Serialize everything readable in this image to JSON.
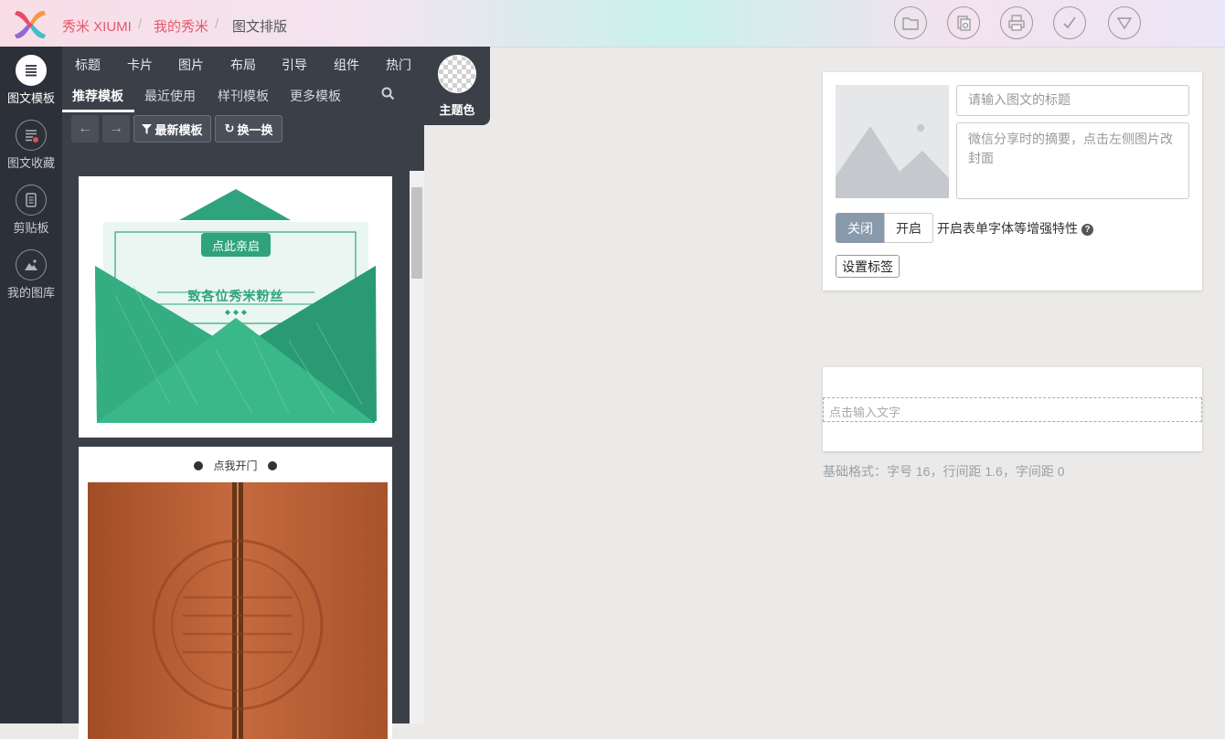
{
  "header": {
    "brand": "秀米 XIUMI",
    "breadcrumbs": [
      "我的秀米",
      "图文排版"
    ],
    "separator": "/",
    "actions": [
      {
        "name": "open-folder",
        "icon": "folder-icon"
      },
      {
        "name": "copy-doc",
        "icon": "copy-doc-icon"
      },
      {
        "name": "print",
        "icon": "printer-icon"
      },
      {
        "name": "save-confirm",
        "icon": "check-icon"
      },
      {
        "name": "more-menu",
        "icon": "triangle-down-icon"
      }
    ]
  },
  "rail": {
    "items": [
      {
        "label": "图文模板",
        "icon": "list-lines-icon",
        "active": true
      },
      {
        "label": "图文收藏",
        "icon": "favorite-list-icon",
        "active": false
      },
      {
        "label": "剪贴板",
        "icon": "clipboard-icon",
        "active": false
      },
      {
        "label": "我的图库",
        "icon": "image-library-icon",
        "active": false
      }
    ]
  },
  "panel": {
    "categories": [
      "标题",
      "卡片",
      "图片",
      "布局",
      "引导",
      "组件",
      "热门"
    ],
    "subtabs": [
      "推荐模板",
      "最近使用",
      "样刊模板",
      "更多模板"
    ],
    "active_subtab": "推荐模板",
    "search_icon": "search-icon",
    "theme_color_label": "主题色",
    "filter_button": "最新模板",
    "shuffle_button": "换一换",
    "templates": [
      {
        "kind": "envelope",
        "button_text": "点此亲启",
        "headline": "致各位秀米粉丝",
        "primary_color": "#2fa37e"
      },
      {
        "kind": "door",
        "prompt_text": "点我开门",
        "primary_color": "#b5653a"
      }
    ]
  },
  "editor": {
    "title_placeholder": "请输入图文的标题",
    "summary_placeholder": "微信分享时的摘要，点击左侧图片改封面",
    "toggle_off": "关闭",
    "toggle_on": "开启",
    "toggle_state": "关闭",
    "enhance_label": "开启表单字体等增强特性",
    "help_icon": "question-circle-icon",
    "tag_button": "设置标签",
    "text_placeholder": "点击输入文字",
    "base_format": "基础格式：字号 16，行间距 1.6，字间距 0"
  }
}
